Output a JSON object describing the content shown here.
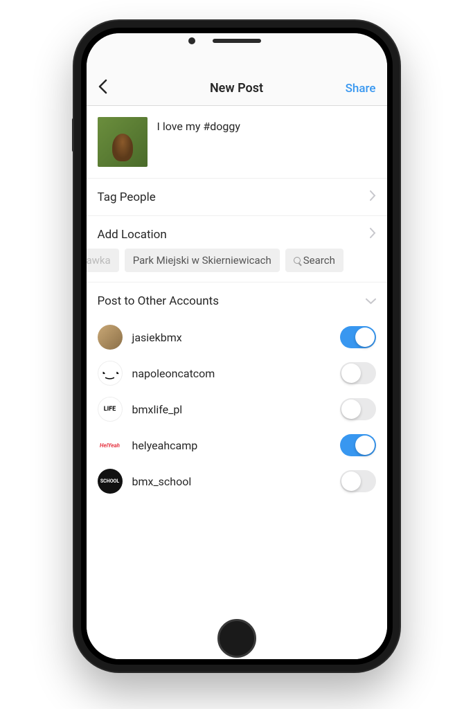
{
  "nav": {
    "title": "New Post",
    "share_label": "Share"
  },
  "caption": {
    "text": "I love my #doggy"
  },
  "rows": {
    "tag_people": "Tag People",
    "add_location": "Add Location"
  },
  "location_chips": {
    "partial": "awka",
    "chip1": "Park Miejski w Skierniewicach",
    "search_label": "Search"
  },
  "section": {
    "post_other": "Post to Other Accounts"
  },
  "accounts": [
    {
      "name": "jasiekbmx",
      "on": true,
      "avatar_label": ""
    },
    {
      "name": "napoleoncatcom",
      "on": false,
      "avatar_label": ""
    },
    {
      "name": "bmxlife_pl",
      "on": false,
      "avatar_label": "LIFE"
    },
    {
      "name": "helyeahcamp",
      "on": true,
      "avatar_label": "HelYeah"
    },
    {
      "name": "bmx_school",
      "on": false,
      "avatar_label": "SCHOOL"
    }
  ]
}
